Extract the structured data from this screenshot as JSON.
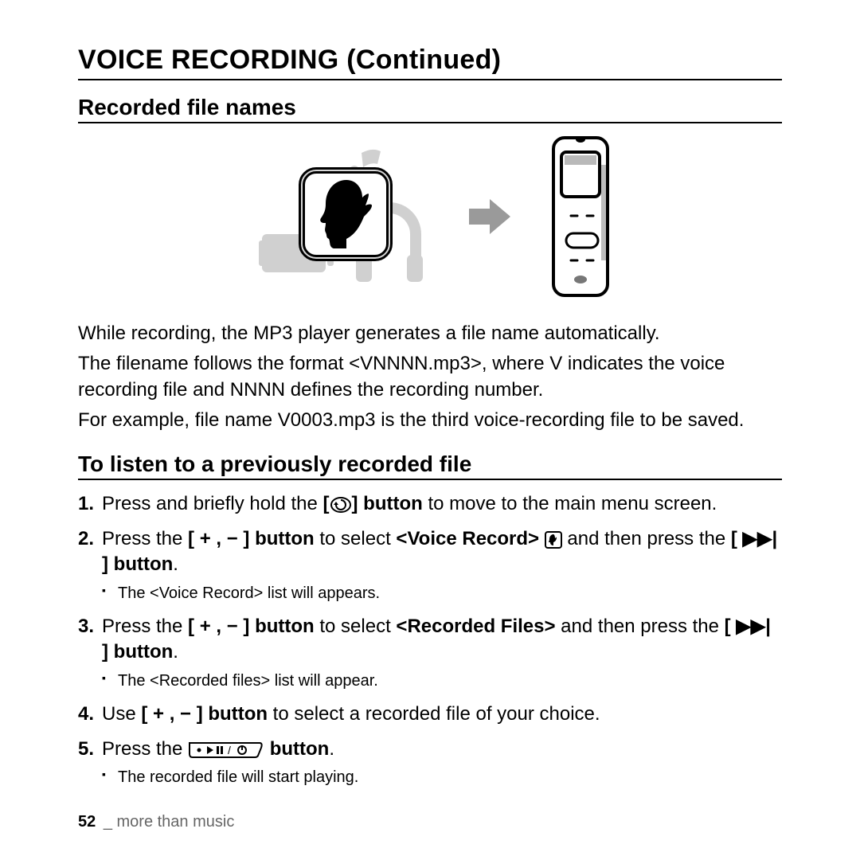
{
  "title": "VOICE RECORDING (Continued)",
  "section1": {
    "heading": "Recorded file names",
    "para1": "While recording, the MP3 player generates a file name automatically.",
    "para2": "The filename follows the format <VNNNN.mp3>, where V indicates the voice recording file and NNNN defines the recording number.",
    "para3": "For example, file name V0003.mp3 is the third voice-recording file to be saved."
  },
  "section2": {
    "heading": "To listen to a previously recorded file",
    "steps": {
      "s1a": "Press and briefly hold the ",
      "s1b": "[",
      "s1c": "] button",
      "s1d": " to move to the main menu screen.",
      "s2a": "Press the ",
      "s2b": "[ + , − ] button",
      "s2c": " to select ",
      "s2d": "<Voice Record>",
      "s2e": " and then press the ",
      "s2f": "[ ▶▶| ] button",
      "s2g": ".",
      "s2sub": "The <Voice Record> list will appears.",
      "s3a": "Press the ",
      "s3b": "[ + , − ] button",
      "s3c": " to select ",
      "s3d": "<Recorded Files>",
      "s3e": " and then press the ",
      "s3f": "[ ▶▶| ] button",
      "s3g": ".",
      "s3sub": "The <Recorded files> list will appear.",
      "s4a": "Use ",
      "s4b": "[ + , − ] button",
      "s4c": " to select a recorded file of your choice.",
      "s5a": "Press the ",
      "s5b": " button",
      "s5c": ".",
      "s5sub": "The recorded file will start playing."
    }
  },
  "footer": {
    "page": "52",
    "sep": "_",
    "text": "more than music"
  }
}
